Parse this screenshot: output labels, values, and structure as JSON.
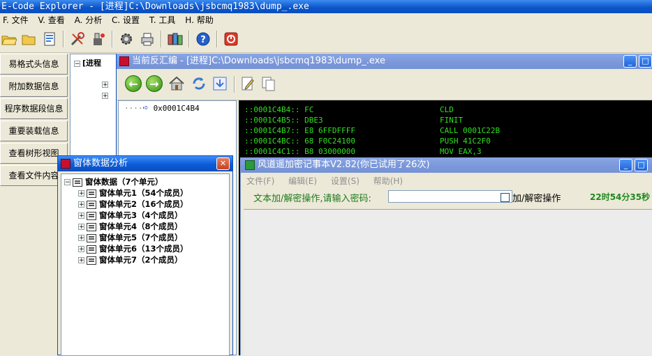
{
  "main_window": {
    "title": "E-Code Explorer - [进程]C:\\Downloads\\jsbcmq1983\\dump_.exe"
  },
  "menu": [
    "F. 文件",
    "V. 查看",
    "A. 分析",
    "C. 设置",
    "T. 工具",
    "H. 帮助"
  ],
  "toolbar_icons": [
    "open-folder-icon",
    "folder-icon",
    "document-icon",
    "tools-icon",
    "paint-icon",
    "gear-icon",
    "print-icon",
    "books-icon",
    "help-icon",
    "stop-icon"
  ],
  "nav": [
    "易格式头信息",
    "附加数据信息",
    "程序数据段信息",
    "重要装载信息",
    "查看树形视图",
    "查看文件内容"
  ],
  "tree_bg": {
    "root_label": "[进程"
  },
  "disasm": {
    "title": "当前反汇编 - [进程]C:\\Downloads\\jsbcmq1983\\dump_.exe",
    "address": "0x0001C4B4",
    "rows": [
      {
        "addr": "::0001C4B4:: FC",
        "instr": "CLD"
      },
      {
        "addr": "::0001C4B5:: DBE3",
        "instr": "FINIT"
      },
      {
        "addr": "::0001C4B7:: E8 6FFDFFFF",
        "instr": "CALL 0001C22B"
      },
      {
        "addr": "::0001C4BC:: 68 F0C24100",
        "instr": "PUSH 41C2F0"
      },
      {
        "addr": "::0001C4C1:: B8 03000000",
        "instr": "MOV EAX,3"
      }
    ]
  },
  "form_analysis": {
    "title": "窗体数据分析",
    "root": "窗体数据（7个单元）",
    "units": [
      "窗体单元1（54个成员）",
      "窗体单元2（16个成员）",
      "窗体单元3（4个成员）",
      "窗体单元4（8个成员）",
      "窗体单元5（7个成员）",
      "窗体单元6（13个成员）",
      "窗体单元7（2个成员）"
    ]
  },
  "notepad": {
    "title": "风道遥加密记事本V2.82(你已试用了26次)",
    "menu": [
      "文件(F)",
      "编辑(E)",
      "设置(S)",
      "帮助(H)"
    ],
    "prompt": "文本加/解密操作,请输入密码:",
    "password_value": "",
    "checkbox_label": "加/解密操作",
    "timer": "22时54分35秒"
  }
}
